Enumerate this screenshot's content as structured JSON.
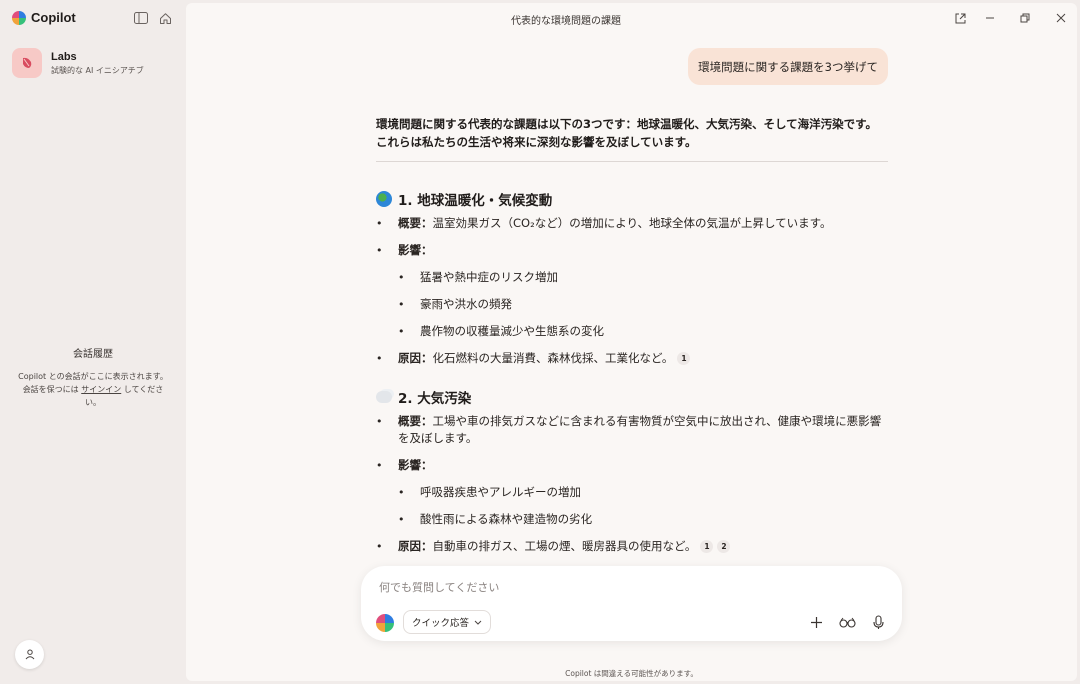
{
  "app": {
    "name": "Copilot"
  },
  "sidebar": {
    "labs_title": "Labs",
    "labs_subtitle": "試験的な AI イニシアチブ",
    "history_title": "会話履歴",
    "history_desc_pre": "Copilot との会話がここに表示されます。会話を保つには ",
    "history_desc_link": "サインイン",
    "history_desc_post": " してください。"
  },
  "window": {
    "title": "代表的な環境問題の課題"
  },
  "chat": {
    "user_message": "環境問題に関する課題を3つ挙げて",
    "intro": "環境問題に関する代表的な課題は以下の3つです：地球温暖化、大気汚染、そして海洋汚染です。これらは私たちの生活や将来に深刻な影響を及ぼしています。",
    "sections": [
      {
        "heading": "1. 地球温暖化・気候変動",
        "overview_label": "概要：",
        "overview_text": "温室効果ガス（CO₂など）の増加により、地球全体の気温が上昇しています。",
        "impact_label": "影響：",
        "impacts": [
          "猛暑や熱中症のリスク増加",
          "豪雨や洪水の頻発",
          "農作物の収穫量減少や生態系の変化"
        ],
        "cause_label": "原因：",
        "cause_text": "化石燃料の大量消費、森林伐採、工業化など。",
        "citations": [
          "1"
        ]
      },
      {
        "heading": "2. 大気汚染",
        "overview_label": "概要：",
        "overview_text": "工場や車の排気ガスなどに含まれる有害物質が空気中に放出され、健康や環境に悪影響を及ぼします。",
        "impact_label": "影響：",
        "impacts": [
          "呼吸器疾患やアレルギーの増加",
          "酸性雨による森林や建造物の劣化"
        ],
        "cause_label": "原因：",
        "cause_text": "自動車の排ガス、工場の煙、暖房器具の使用など。",
        "citations": [
          "1",
          "2"
        ]
      }
    ]
  },
  "composer": {
    "placeholder": "何でも質問してください",
    "mode_label": "クイック応答"
  },
  "disclaimer": "Copilot は間違える可能性があります。"
}
